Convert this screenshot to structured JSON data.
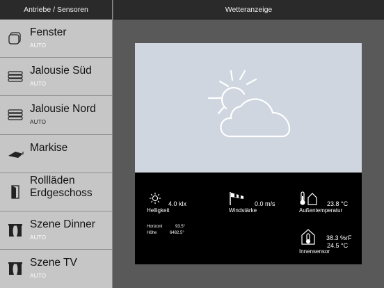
{
  "sidebar": {
    "header": "Antriebe / Sensoren",
    "items": [
      {
        "title": "Fenster",
        "status": "AUTO",
        "icon": "window-icon"
      },
      {
        "title": "Jalousie Süd",
        "status": "AUTO",
        "icon": "blind-icon"
      },
      {
        "title": "Jalousie Nord",
        "status": "AUTO",
        "icon": "blind-icon"
      },
      {
        "title": "Markise",
        "status": "",
        "icon": "awning-icon"
      },
      {
        "title_line1": "Rollläden",
        "title_line2": "Erdgeschoss",
        "status": "",
        "icon": "door-icon"
      },
      {
        "title": "Szene Dinner",
        "status": "AUTO",
        "icon": "curtain-icon"
      },
      {
        "title": "Szene TV",
        "status": "AUTO",
        "icon": "curtain-icon"
      }
    ]
  },
  "main": {
    "header": "Wetteranzeige",
    "weather_icon": "sun-cloud-icon",
    "sensors": {
      "brightness": {
        "value": "4.0 klx",
        "label": "Helligkeit",
        "horizon_label": "Horizont",
        "horizon_value": "93.5°",
        "height_label": "Höhe",
        "height_value": "6482.5°"
      },
      "wind": {
        "value": "0.0 m/s",
        "label": "Windstärke"
      },
      "outdoor": {
        "value": "23.8 °C",
        "label": "Außentemperatur"
      },
      "indoor": {
        "humidity": "38.3 %rF",
        "temperature": "24.5 °C",
        "label": "Innensensor"
      }
    }
  }
}
